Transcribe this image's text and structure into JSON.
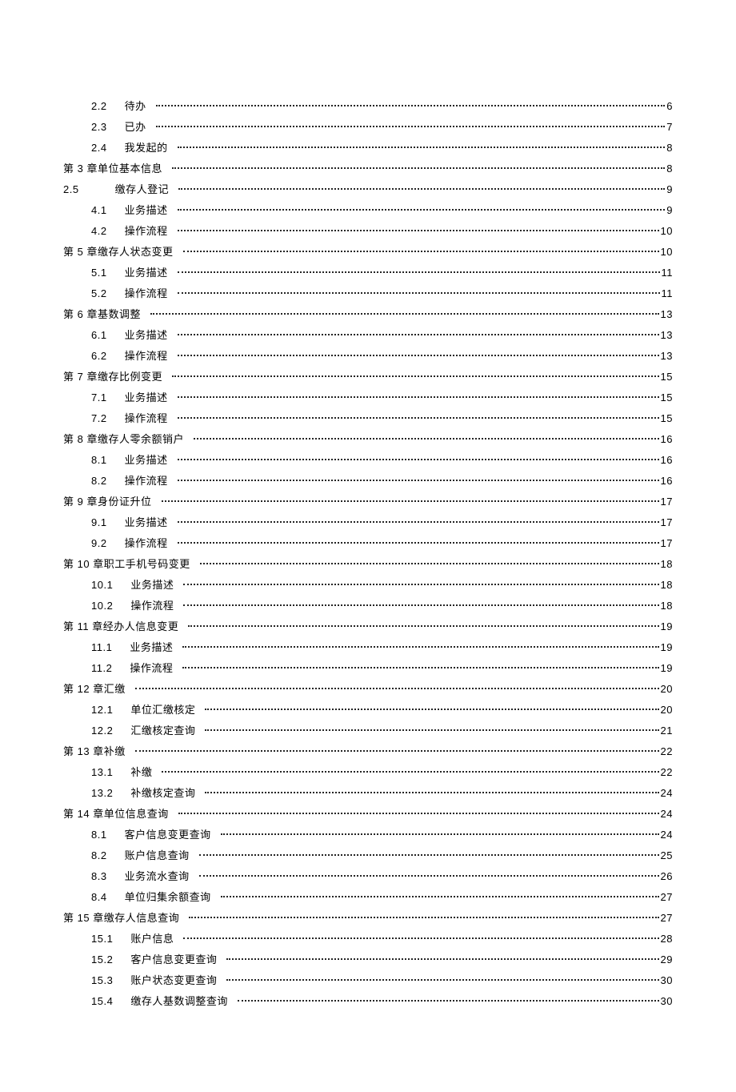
{
  "toc": [
    {
      "level": "level-2",
      "num": "2.2",
      "title": "待办",
      "gap": "wide",
      "page": "6"
    },
    {
      "level": "level-2",
      "num": "2.3",
      "title": "已办",
      "gap": "wide",
      "page": "7"
    },
    {
      "level": "level-2",
      "num": "2.4",
      "title": "我发起的",
      "gap": "wide",
      "page": "8"
    },
    {
      "level": "level-1",
      "num": "第 3 章",
      "title": "单位基本信息",
      "gap": "none",
      "page": "8"
    },
    {
      "level": "level-2b",
      "num": "2.5",
      "title": "缴存人登记",
      "gap": "xwide",
      "page": "9"
    },
    {
      "level": "level-2",
      "num": "4.1",
      "title": "业务描述",
      "gap": "wide",
      "page": "9"
    },
    {
      "level": "level-2",
      "num": "4.2",
      "title": "操作流程",
      "gap": "wide",
      "page": "10"
    },
    {
      "level": "level-1",
      "num": "第 5 章",
      "title": "缴存人状态变更",
      "gap": "none",
      "page": "10"
    },
    {
      "level": "level-2",
      "num": "5.1",
      "title": "业务描述",
      "gap": "wide",
      "page": "11"
    },
    {
      "level": "level-2",
      "num": "5.2",
      "title": "操作流程",
      "gap": "wide",
      "page": "11"
    },
    {
      "level": "level-1",
      "num": "第 6 章",
      "title": "基数调整",
      "gap": "none",
      "page": "13"
    },
    {
      "level": "level-2",
      "num": "6.1",
      "title": "业务描述",
      "gap": "wide",
      "page": "13"
    },
    {
      "level": "level-2",
      "num": "6.2",
      "title": "操作流程",
      "gap": "wide",
      "page": "13"
    },
    {
      "level": "level-1",
      "num": "第 7 章",
      "title": "缴存比例变更",
      "gap": "none",
      "page": "15"
    },
    {
      "level": "level-2",
      "num": "7.1",
      "title": "业务描述",
      "gap": "wide",
      "page": "15"
    },
    {
      "level": "level-2",
      "num": "7.2",
      "title": "操作流程",
      "gap": "wide",
      "page": "15"
    },
    {
      "level": "level-1",
      "num": "第 8 章",
      "title": "缴存人零余额销户",
      "gap": "none",
      "page": "16"
    },
    {
      "level": "level-2",
      "num": "8.1",
      "title": "业务描述",
      "gap": "wide",
      "page": "16"
    },
    {
      "level": "level-2",
      "num": "8.2",
      "title": "操作流程",
      "gap": "wide",
      "page": "16"
    },
    {
      "level": "level-1",
      "num": "第 9 章",
      "title": "身份证升位",
      "gap": "none",
      "page": "17"
    },
    {
      "level": "level-2",
      "num": "9.1",
      "title": "业务描述",
      "gap": "wide",
      "page": "17"
    },
    {
      "level": "level-2",
      "num": "9.2",
      "title": "操作流程",
      "gap": "wide",
      "page": "17"
    },
    {
      "level": "level-1",
      "num": "第 10 章",
      "title": "职工手机号码变更",
      "gap": "none",
      "page": "18"
    },
    {
      "level": "level-2",
      "num": "10.1",
      "title": "业务描述",
      "gap": "wide",
      "page": "18"
    },
    {
      "level": "level-2",
      "num": "10.2",
      "title": "操作流程",
      "gap": "wide",
      "page": "18"
    },
    {
      "level": "level-1",
      "num": "第 11 章",
      "title": "经办人信息变更",
      "gap": "none",
      "page": "19"
    },
    {
      "level": "level-2",
      "num": "11.1",
      "title": "业务描述",
      "gap": "wide",
      "page": "19"
    },
    {
      "level": "level-2",
      "num": "11.2",
      "title": "操作流程",
      "gap": "wide",
      "page": "19"
    },
    {
      "level": "level-1",
      "num": "第 12 章",
      "title": "汇缴",
      "gap": "none",
      "page": "20"
    },
    {
      "level": "level-2",
      "num": "12.1",
      "title": "单位汇缴核定",
      "gap": "wide",
      "page": "20"
    },
    {
      "level": "level-2",
      "num": "12.2",
      "title": "汇缴核定查询",
      "gap": "wide",
      "page": "21"
    },
    {
      "level": "level-1",
      "num": "第 13 章",
      "title": "补缴",
      "gap": "none",
      "page": "22"
    },
    {
      "level": "level-2",
      "num": "13.1",
      "title": "补缴",
      "gap": "wide",
      "page": "22"
    },
    {
      "level": "level-2",
      "num": "13.2",
      "title": "补缴核定查询",
      "gap": "wide",
      "page": "24"
    },
    {
      "level": "level-1",
      "num": "第 14 章",
      "title": "单位信息查询",
      "gap": "none",
      "page": "24"
    },
    {
      "level": "level-2",
      "num": "8.1",
      "title": "客户信息变更查询",
      "gap": "wide",
      "page": "24"
    },
    {
      "level": "level-2",
      "num": "8.2",
      "title": "账户信息查询",
      "gap": "wide",
      "page": "25"
    },
    {
      "level": "level-2",
      "num": "8.3",
      "title": "业务流水查询",
      "gap": "wide",
      "page": "26"
    },
    {
      "level": "level-2",
      "num": "8.4",
      "title": "单位归集余额查询",
      "gap": "wide",
      "page": "27"
    },
    {
      "level": "level-1",
      "num": "第 15 章",
      "title": "缴存人信息查询",
      "gap": "none",
      "page": "27"
    },
    {
      "level": "level-2",
      "num": "15.1",
      "title": "账户信息",
      "gap": "wide",
      "page": "28"
    },
    {
      "level": "level-2",
      "num": "15.2",
      "title": "客户信息变更查询",
      "gap": "wide",
      "page": "29"
    },
    {
      "level": "level-2",
      "num": "15.3",
      "title": "账户状态变更查询",
      "gap": "wide",
      "page": "30"
    },
    {
      "level": "level-2",
      "num": "15.4",
      "title": "缴存人基数调整查询",
      "gap": "wide",
      "page": "30"
    }
  ]
}
